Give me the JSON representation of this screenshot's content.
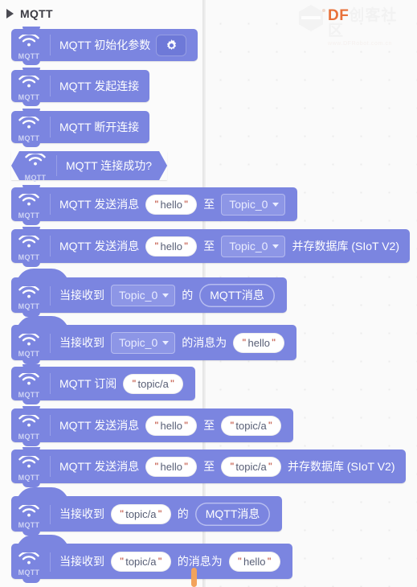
{
  "category": {
    "label": "MQTT",
    "expand_icon": "triangle-right-icon"
  },
  "watermark": {
    "brand": "DF",
    "brand_cn": "创客社区",
    "url": "www.DFRobot.com.cn",
    "logo_icon": "df-hex-logo-icon",
    "accent_color": "#e8713a"
  },
  "palette": {
    "block_color": "#7b85e0",
    "field_color": "#8d96e6",
    "input_text_color": "#575e75",
    "quote_color": "#c96a5a"
  },
  "blocks": [
    {
      "id": "mqtt-init",
      "kind": "stack",
      "icon": "mqtt-wifi-icon",
      "icon_label": "MQTT",
      "text": "MQTT 初始化参数",
      "gear": "gear-icon"
    },
    {
      "id": "mqtt-connect",
      "kind": "stack",
      "icon": "mqtt-wifi-icon",
      "icon_label": "MQTT",
      "text": "MQTT 发起连接"
    },
    {
      "id": "mqtt-disconnect",
      "kind": "stack",
      "icon": "mqtt-wifi-icon",
      "icon_label": "MQTT",
      "text": "MQTT 断开连接"
    },
    {
      "id": "mqtt-connected",
      "kind": "boolean",
      "icon": "mqtt-wifi-icon",
      "icon_label": "MQTT",
      "text": "MQTT 连接成功?"
    },
    {
      "id": "mqtt-publish-topic0",
      "kind": "stack",
      "icon": "mqtt-wifi-icon",
      "icon_label": "MQTT",
      "text_1": "MQTT 发送消息",
      "input_1": "hello",
      "text_2": "至",
      "dropdown_1": "Topic_0"
    },
    {
      "id": "mqtt-publish-topic0-siot",
      "kind": "stack",
      "icon": "mqtt-wifi-icon",
      "icon_label": "MQTT",
      "text_1": "MQTT 发送消息",
      "input_1": "hello",
      "text_2": "至",
      "dropdown_1": "Topic_0",
      "text_3": "并存数据库 (SIoT V2)"
    },
    {
      "id": "mqtt-on-message-topic0",
      "kind": "hat",
      "icon": "mqtt-wifi-icon",
      "icon_label": "MQTT",
      "text_1": "当接收到",
      "dropdown_1": "Topic_0",
      "text_2": "的",
      "reporter_1": "MQTT消息"
    },
    {
      "id": "mqtt-on-message-equals-topic0",
      "kind": "hat",
      "icon": "mqtt-wifi-icon",
      "icon_label": "MQTT",
      "text_1": "当接收到",
      "dropdown_1": "Topic_0",
      "text_2": "的消息为",
      "input_1": "hello"
    },
    {
      "id": "mqtt-subscribe",
      "kind": "stack",
      "icon": "mqtt-wifi-icon",
      "icon_label": "MQTT",
      "text_1": "MQTT 订阅",
      "input_1": "topic/a"
    },
    {
      "id": "mqtt-publish-custom",
      "kind": "stack",
      "icon": "mqtt-wifi-icon",
      "icon_label": "MQTT",
      "text_1": "MQTT 发送消息",
      "input_1": "hello",
      "text_2": "至",
      "input_2": "topic/a"
    },
    {
      "id": "mqtt-publish-custom-siot",
      "kind": "stack",
      "icon": "mqtt-wifi-icon",
      "icon_label": "MQTT",
      "text_1": "MQTT 发送消息",
      "input_1": "hello",
      "text_2": "至",
      "input_2": "topic/a",
      "text_3": "并存数据库 (SIoT V2)"
    },
    {
      "id": "mqtt-on-message-custom",
      "kind": "hat",
      "icon": "mqtt-wifi-icon",
      "icon_label": "MQTT",
      "text_1": "当接收到",
      "input_1": "topic/a",
      "text_2": "的",
      "reporter_1": "MQTT消息"
    },
    {
      "id": "mqtt-on-message-equals-custom",
      "kind": "hat",
      "icon": "mqtt-wifi-icon",
      "icon_label": "MQTT",
      "text_1": "当接收到",
      "input_1": "topic/a",
      "text_2": "的消息为",
      "input_2": "hello"
    }
  ]
}
